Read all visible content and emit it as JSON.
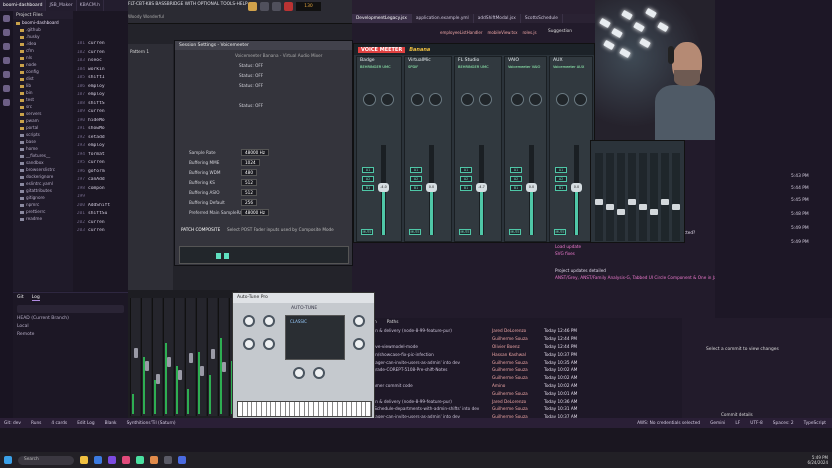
{
  "ide": {
    "tabs": [
      "boomi-dashboard",
      "JSB_Maker",
      "KBACM.h"
    ],
    "explorer_title": "Project Files",
    "explorer_root": "boomi-dashboard",
    "files": [
      ".github",
      ".husky",
      ".idea",
      "cfm",
      "nls",
      "node",
      "config",
      "dist",
      "lib",
      "bin",
      "test",
      "src",
      "servers",
      "pwam",
      "portal",
      "scripts",
      "base",
      "home",
      "__fixtures__",
      "sandbox",
      "browserslistrc",
      "dockerignore",
      "eslintrc.yaml",
      "gitattributes",
      "gitignore",
      "npmrc",
      "prettierrc",
      "readme"
    ],
    "code_lines": [
      {
        "n": "181",
        "t": "curren"
      },
      {
        "n": "182",
        "t": "curren"
      },
      {
        "n": "183",
        "t": "nseoc"
      },
      {
        "n": "184",
        "t": "workin"
      },
      {
        "n": "185",
        "t": "shiftI"
      },
      {
        "n": "186",
        "t": "employ"
      },
      {
        "n": "187",
        "t": "employ"
      },
      {
        "n": "188",
        "t": "shiftS"
      },
      {
        "n": "189",
        "t": "curren"
      },
      {
        "n": "190",
        "t": "hideMo"
      },
      {
        "n": "191",
        "t": "showMo"
      },
      {
        "n": "192",
        "t": "setadd"
      },
      {
        "n": "193",
        "t": "employ"
      },
      {
        "n": "194",
        "t": "format"
      },
      {
        "n": "195",
        "t": "curren"
      },
      {
        "n": "196",
        "t": "goform"
      },
      {
        "n": "197",
        "t": "canAdd"
      },
      {
        "n": "198",
        "t": "compon"
      },
      {
        "n": "199",
        "t": ""
      },
      {
        "n": "200",
        "t": "AddShift"
      },
      {
        "n": "201",
        "t": "shiftSu"
      },
      {
        "n": "202",
        "t": "curren"
      },
      {
        "n": "203",
        "t": "curren"
      }
    ],
    "git_tabs": [
      "Git",
      "Log"
    ],
    "git_items": [
      "HEAD (Current Branch)",
      "Local",
      "Remote"
    ],
    "statusbar": [
      "boomi-dashboard",
      "nact",
      "dashboard",
      "components"
    ]
  },
  "daw": {
    "title": "FLT-CBT-K8S BASSBRIDGE WITH OPTIONAL TOOLS-HELP",
    "sub": "Woody Wonderful",
    "track": "Pattern 1",
    "routing": {
      "title": "Session Settings - Voicemeeter",
      "subtitle": "Voicemeeter Banana - Virtual Audio Mixer",
      "rows": [
        {
          "l": "Sample Rate",
          "v": "48000 Hz"
        },
        {
          "l": "Buffering MME",
          "v": "1024"
        },
        {
          "l": "Buffering WDM",
          "v": "480"
        },
        {
          "l": "Buffering KS",
          "v": "512"
        },
        {
          "l": "Buffering ASIO",
          "v": "512"
        },
        {
          "l": "Buffering Default",
          "v": "256"
        },
        {
          "l": "Preferred Main SampleRate",
          "v": "48000 Hz"
        }
      ],
      "patch": "PATCH COMPOSITE",
      "patch_note": "Select POST Fader inputs used by Composite Mode",
      "status": "Status: OFF"
    }
  },
  "vm": {
    "logo": "VOICE MEETER",
    "banner": "Banana",
    "strips": [
      "Badge",
      "VirtualMic",
      "FL Studio",
      "VAIO",
      "AUX"
    ],
    "subs": [
      "BEHRINGER UMC",
      "SPDIF",
      "BEHRINGER UMC",
      "Voicemeeter VAIO",
      "Voicemeeter AUX"
    ],
    "gains": [
      "-4.0",
      "0.0",
      "-4.7",
      "0.0",
      "0.0"
    ],
    "fader_labels": [
      "Badge",
      "VirtualMic",
      "FL Studio",
      "VAIO",
      "AUX"
    ],
    "bus_labels": [
      "A1",
      "A2",
      "B1",
      "MONO",
      "SOLO",
      "MUTE"
    ],
    "master": [
      "Master",
      "Bus A1",
      "Bus A2",
      "B1",
      "B2"
    ]
  },
  "synth": {
    "title": "AUTO-TUNE",
    "plugin": "Auto-Tune Pro",
    "label": "CLASSIC"
  },
  "reditor": {
    "tabs": [
      "DevelopmentLegacy.jsx",
      "application.example.yml",
      "addShiftModal.jsx",
      "ScottsSchedule"
    ],
    "subtabs": [
      "employeeListHandler",
      "mobileView.tsx",
      "roles.js"
    ],
    "suggest": "Suggestion",
    "body_lines": [
      "Are you sure the default is more about how the 'save' is expected?",
      "SVG updates",
      "Load update",
      "SVG fixes"
    ],
    "pr_title": "Project updates detailed",
    "pr_body": "ANST/Grey, ANST/Family Analysis-G, Tabbed UI Circle Component & One in Java (API) Python & More",
    "right_text": "Select a commit to view changes",
    "right_text2": "Commit details"
  },
  "gitlog": {
    "branch": "main",
    "paths": "Paths",
    "rows": [
      {
        "m": "origin & delivery (node-8-99-feature-pur)",
        "a": "Jared DeLorenzo",
        "t": "Today 12:46 PM"
      },
      {
        "m": "",
        "a": "Guilherme Souza",
        "t": "Today 12:44 PM"
      },
      {
        "m": "aprove-viewmodel-mode",
        "a": "Olivier Boenz",
        "t": "Today 12:44 PM"
      },
      {
        "m": "origin/showcase-fix-pic-infection",
        "a": "Hassan Kashwal",
        "t": "Today 10:37 PM"
      },
      {
        "m": "manager-can-invite-users-as-admin' into dev",
        "a": "Guilherme Souza",
        "t": "Today 10:35 AM"
      },
      {
        "m": "-upgrade-COREPT-5108-Pre-shift-Notes",
        "a": "Guilherme Souza",
        "t": "Today 10:02 AM"
      },
      {
        "m": "",
        "a": "Guilherme Souza",
        "t": "Today 10:02 AM"
      },
      {
        "m": "Hammer commit code",
        "a": "Amino",
        "t": "Today 10:02 AM"
      },
      {
        "m": "",
        "a": "Guilherme Souza",
        "t": "Today 10:01 AM"
      },
      {
        "m": "origin & delivery (node-8-99-feature-pur)",
        "a": "Jared DeLorenzo",
        "t": "Today 10:36 AM"
      },
      {
        "m": "DaySchedule-departments-with-admin-shifts' into dev",
        "a": "Guilherme Souza",
        "t": "Today 10:31 AM"
      },
      {
        "m": "manager-can-invite-users-as-admin' into dev",
        "a": "Guilherme Souza",
        "t": "Today 10:37 AM"
      },
      {
        "m": "service",
        "a": "Guilherme Souza",
        "t": "Today 10:37 AM"
      }
    ]
  },
  "farright": {
    "times": [
      "5:43 PM",
      "5:44 PM",
      "5:45 PM",
      "5:48 PM",
      "5:49 PM",
      "5:49 PM"
    ]
  },
  "status": {
    "items": [
      "Git: dev",
      "Runs",
      "4 cards",
      "Edit Log",
      "Blank",
      "Synthitions'Til (Saturn)"
    ],
    "right": [
      "AWS: No credentials selected",
      "Gemini",
      "LF",
      "UTF-8",
      "Spaces: 2",
      "TypeScript"
    ]
  },
  "taskbar": {
    "search": "Search",
    "time": "5:49 PM",
    "date": "6/24/2024"
  }
}
